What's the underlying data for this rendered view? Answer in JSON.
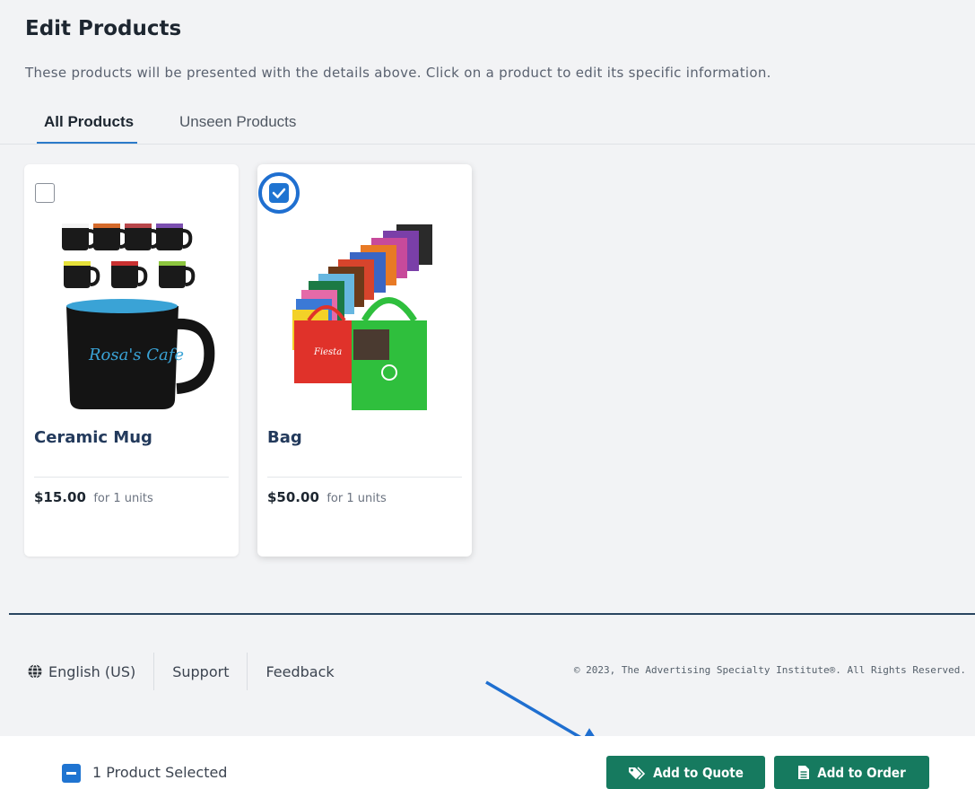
{
  "header": {
    "title": "Edit Products",
    "description": "These products will be presented with the details above. Click on a product to edit its specific information."
  },
  "tabs": [
    {
      "label": "All Products",
      "active": true
    },
    {
      "label": "Unseen Products",
      "active": false
    }
  ],
  "products": [
    {
      "name": "Ceramic Mug",
      "price": "$15.00",
      "unit_note": "for 1 units",
      "selected": false,
      "icon": "mug-image"
    },
    {
      "name": "Bag",
      "price": "$50.00",
      "unit_note": "for 1 units",
      "selected": true,
      "icon": "bag-image"
    }
  ],
  "footer": {
    "language": "English (US)",
    "support": "Support",
    "feedback": "Feedback",
    "copyright": "© 2023, The Advertising Specialty Institute®. All Rights Reserved."
  },
  "selection_bar": {
    "status": "1 Product Selected",
    "add_to_quote": "Add to Quote",
    "add_to_order": "Add to Order"
  },
  "colors": {
    "accent_blue": "#1f74d1",
    "button_green": "#167a5f",
    "annotation_blue": "#1f6fd0"
  }
}
